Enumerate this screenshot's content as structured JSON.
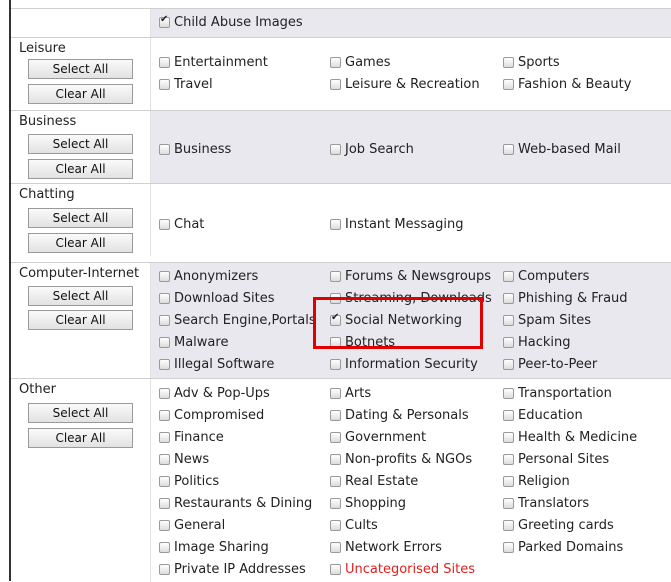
{
  "top_item": {
    "label": "Child Abuse Images",
    "checked": true
  },
  "buttons": {
    "select_all": "Select All",
    "clear_all": "Clear All"
  },
  "sections": [
    {
      "title": "Leisure",
      "items": [
        {
          "label": "Entertainment",
          "checked": false
        },
        {
          "label": "Games",
          "checked": false
        },
        {
          "label": "Sports",
          "checked": false
        },
        {
          "label": "Travel",
          "checked": false
        },
        {
          "label": "Leisure & Recreation",
          "checked": false
        },
        {
          "label": "Fashion & Beauty",
          "checked": false
        }
      ]
    },
    {
      "title": "Business",
      "items": [
        {
          "label": "Business",
          "checked": false
        },
        {
          "label": "Job Search",
          "checked": false
        },
        {
          "label": "Web-based Mail",
          "checked": false
        }
      ]
    },
    {
      "title": "Chatting",
      "items": [
        {
          "label": "Chat",
          "checked": false
        },
        {
          "label": "Instant Messaging",
          "checked": false
        }
      ]
    },
    {
      "title": "Computer-Internet",
      "items": [
        {
          "label": "Anonymizers",
          "checked": false
        },
        {
          "label": "Forums & Newsgroups",
          "checked": false
        },
        {
          "label": "Computers",
          "checked": false
        },
        {
          "label": "Download Sites",
          "checked": false
        },
        {
          "label": "Streaming, Downloads",
          "checked": false
        },
        {
          "label": "Phishing & Fraud",
          "checked": false
        },
        {
          "label": "Search Engine,Portals",
          "checked": false
        },
        {
          "label": "Social Networking",
          "checked": true
        },
        {
          "label": "Spam Sites",
          "checked": false
        },
        {
          "label": "Malware",
          "checked": false
        },
        {
          "label": "Botnets",
          "checked": false
        },
        {
          "label": "Hacking",
          "checked": false
        },
        {
          "label": "Illegal Software",
          "checked": false
        },
        {
          "label": "Information Security",
          "checked": false
        },
        {
          "label": "Peer-to-Peer",
          "checked": false
        }
      ]
    },
    {
      "title": "Other",
      "items": [
        {
          "label": "Adv & Pop-Ups",
          "checked": false
        },
        {
          "label": "Arts",
          "checked": false
        },
        {
          "label": "Transportation",
          "checked": false
        },
        {
          "label": "Compromised",
          "checked": false
        },
        {
          "label": "Dating & Personals",
          "checked": false
        },
        {
          "label": "Education",
          "checked": false
        },
        {
          "label": "Finance",
          "checked": false
        },
        {
          "label": "Government",
          "checked": false
        },
        {
          "label": "Health & Medicine",
          "checked": false
        },
        {
          "label": "News",
          "checked": false
        },
        {
          "label": "Non-profits & NGOs",
          "checked": false
        },
        {
          "label": "Personal Sites",
          "checked": false
        },
        {
          "label": "Politics",
          "checked": false
        },
        {
          "label": "Real Estate",
          "checked": false
        },
        {
          "label": "Religion",
          "checked": false
        },
        {
          "label": "Restaurants & Dining",
          "checked": false
        },
        {
          "label": "Shopping",
          "checked": false
        },
        {
          "label": "Translators",
          "checked": false
        },
        {
          "label": "General",
          "checked": false
        },
        {
          "label": "Cults",
          "checked": false
        },
        {
          "label": "Greeting cards",
          "checked": false
        },
        {
          "label": "Image Sharing",
          "checked": false
        },
        {
          "label": "Network Errors",
          "checked": false
        },
        {
          "label": "Parked Domains",
          "checked": false
        },
        {
          "label": "Private IP Addresses",
          "checked": false
        },
        {
          "label": "Uncategorised Sites",
          "checked": false,
          "color": "#e02020"
        }
      ]
    }
  ],
  "colors": {
    "highlight_box": "#e00000",
    "section_shade": "#e8e8ee",
    "warning_text": "#e02020"
  }
}
